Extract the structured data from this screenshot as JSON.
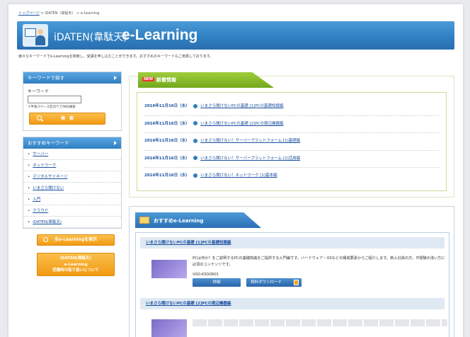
{
  "breadcrumb": {
    "home": "トップページ",
    "parent": "iDATEN（韋駄天）",
    "current": "e-Learning",
    "sep": ">"
  },
  "header": {
    "title_jp": "iDATEN(韋駄天)",
    "title_en": "e-Learning"
  },
  "intro": "様々なキーワードでe-Learningを検索し、受講を申し込むことができます。おすすめのキーワードもご用意しております。",
  "keyword_search": {
    "heading": "キーワードで探す",
    "label": "キーワード",
    "value": "",
    "note": "＊半角スペース区切りでAND検索",
    "button": "検　索"
  },
  "recommended_keywords": {
    "heading": "おすすめキーワード",
    "items": [
      "サーバー",
      "ネットワーク",
      "デジタルサイネージ",
      "いまさら聞けない",
      "入門",
      "クラウド",
      "iDATEN(韋駄天)"
    ]
  },
  "side_buttons": {
    "show_all": "全e-Learningを表示",
    "about_line1": "iDATEN(韋駄天)",
    "about_line2": "e-Learning",
    "about_line3": "受講時の取り扱いについて"
  },
  "news": {
    "badge": "NEW",
    "heading": "新着情報",
    "items": [
      {
        "date": "2016年11月16日（水）",
        "title": "いまさら聞けないPCの基礎 [1]PCの基礎知識編"
      },
      {
        "date": "2016年11月16日（水）",
        "title": "いまさら聞けないPCの基礎 [2]PCの周辺機器編"
      },
      {
        "date": "2016年11月16日（水）",
        "title": "いまさら聞けない！サーバープラットフォーム [1]基礎編"
      },
      {
        "date": "2016年11月16日（水）",
        "title": "いまさら聞けない！サーバープラットフォーム [2]活用編"
      },
      {
        "date": "2016年11月16日（水）",
        "title": "いまさら聞けない！ネットワーク [1]基本編"
      }
    ]
  },
  "recommended": {
    "heading": "おすすめe-Learning",
    "course1": {
      "title": "いまさら聞けないPCの基礎 [1]PCの基礎知識編",
      "desc": "PCは何か？をご説明するPCの基礎知識をご提供する入門編です。ハードウェア・OSなどの構成要素からご紹介します。新入社員の方、IT経験の浅い方に必須のコンテンツです。",
      "code": "VOD-K5DOR01",
      "detail_button": "詳細",
      "download_button": "資料ダウンロード"
    },
    "course2": {
      "title": "いまさら聞けないPCの基礎 [2]PCの周辺機器編"
    }
  },
  "colors": {
    "header_blue": "#2f7fc1",
    "news_green": "#8abf2e",
    "button_orange": "#f29a12",
    "link_blue": "#1a4fa0"
  }
}
